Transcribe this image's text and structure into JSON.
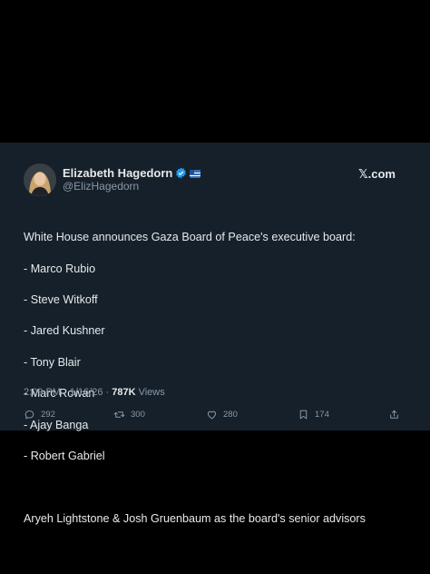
{
  "author": {
    "name": "Elizabeth Hagedorn",
    "handle": "@ElizHagedorn"
  },
  "brand": "𝕏.com",
  "tweet": {
    "lines": [
      "White House announces Gaza Board of Peace's executive board:",
      "- Marco Rubio",
      "- Steve Witkoff",
      "- Jared Kushner",
      "- Tony Blair",
      "- Marc Rowan",
      "- Ajay Banga",
      "- Robert Gabriel",
      "",
      "Aryeh Lightstone & Josh Gruenbaum as the board's senior advisors"
    ]
  },
  "meta": {
    "time": "2:09 PM",
    "separator": " · ",
    "date": "1/16/26",
    "views_count": "787K",
    "views_label": " Views"
  },
  "actions": {
    "replies": "292",
    "retweets": "300",
    "likes": "280",
    "bookmarks": "174"
  },
  "colors": {
    "card_bg": "#15202b",
    "text": "#e7e9ea",
    "muted": "#8b98a5",
    "verified": "#1d9bf0"
  }
}
